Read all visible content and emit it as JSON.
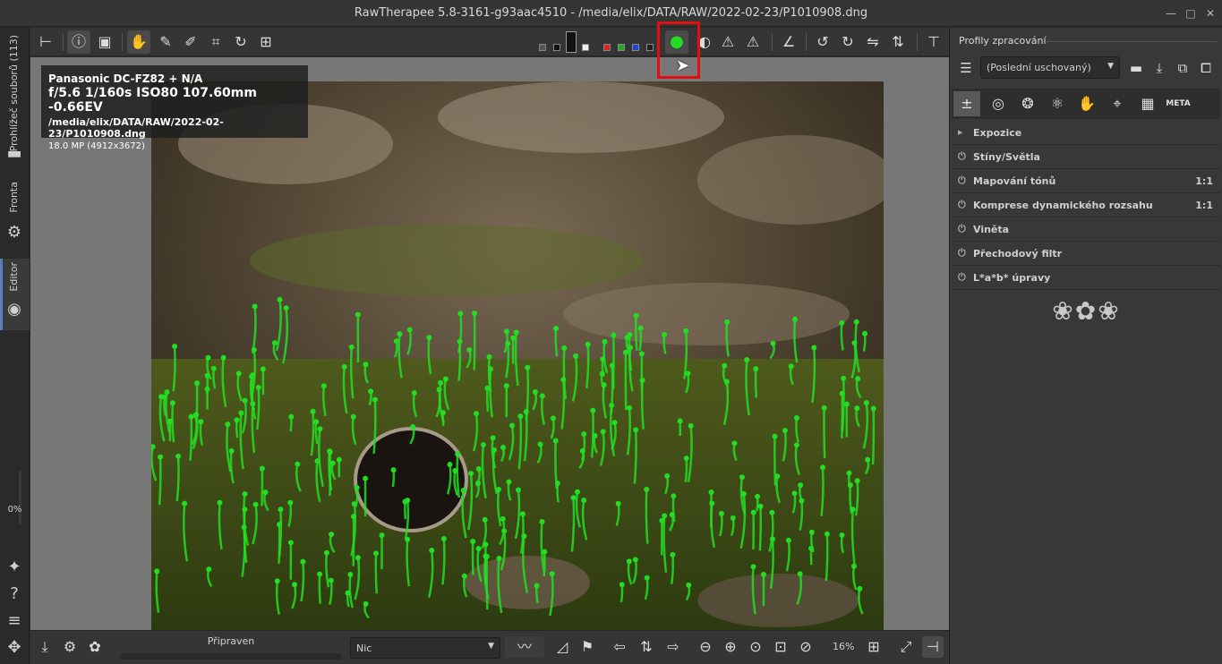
{
  "window": {
    "title": "RawTherapee 5.8-3161-g93aac4510 - /media/elix/DATA/RAW/2022-02-23/P1010908.dng"
  },
  "left_tabs": {
    "file_browser": "Prohlížeč souborů (113)",
    "queue": "Fronta",
    "editor": "Editor",
    "progress_percent": "0%"
  },
  "info_overlay": {
    "camera": "Panasonic DC-FZ82 + N/A",
    "exposure": "f/5.6  1/160s  ISO80  107.60mm  -0.66EV",
    "path": "/media/elix/DATA/RAW/2022-02-23/P1010908.dng",
    "size": "18.0 MP (4912x3672)"
  },
  "bottom_bar": {
    "status": "Připraven",
    "preview_mode": "Nic",
    "zoom": "16%"
  },
  "right_panel": {
    "title": "Profily zpracování",
    "profile_selected": "(Poslední uschovaný)",
    "tools": [
      {
        "label": "Expozice",
        "icon": "expand-arrow",
        "right": ""
      },
      {
        "label": "Stíny/Světla",
        "icon": "power",
        "right": ""
      },
      {
        "label": "Mapování tónů",
        "icon": "power",
        "right": "1:1"
      },
      {
        "label": "Komprese dynamického rozsahu",
        "icon": "power",
        "right": "1:1"
      },
      {
        "label": "Viněta",
        "icon": "power",
        "right": ""
      },
      {
        "label": "Přechodový filtr",
        "icon": "power",
        "right": ""
      },
      {
        "label": "L*a*b* úpravy",
        "icon": "power",
        "right": ""
      }
    ],
    "meta_tab_label": "META"
  },
  "colors": {
    "highlight": "#e01010",
    "focus_mask": "#22dd22",
    "accent_tab": "#5a7fb8"
  }
}
